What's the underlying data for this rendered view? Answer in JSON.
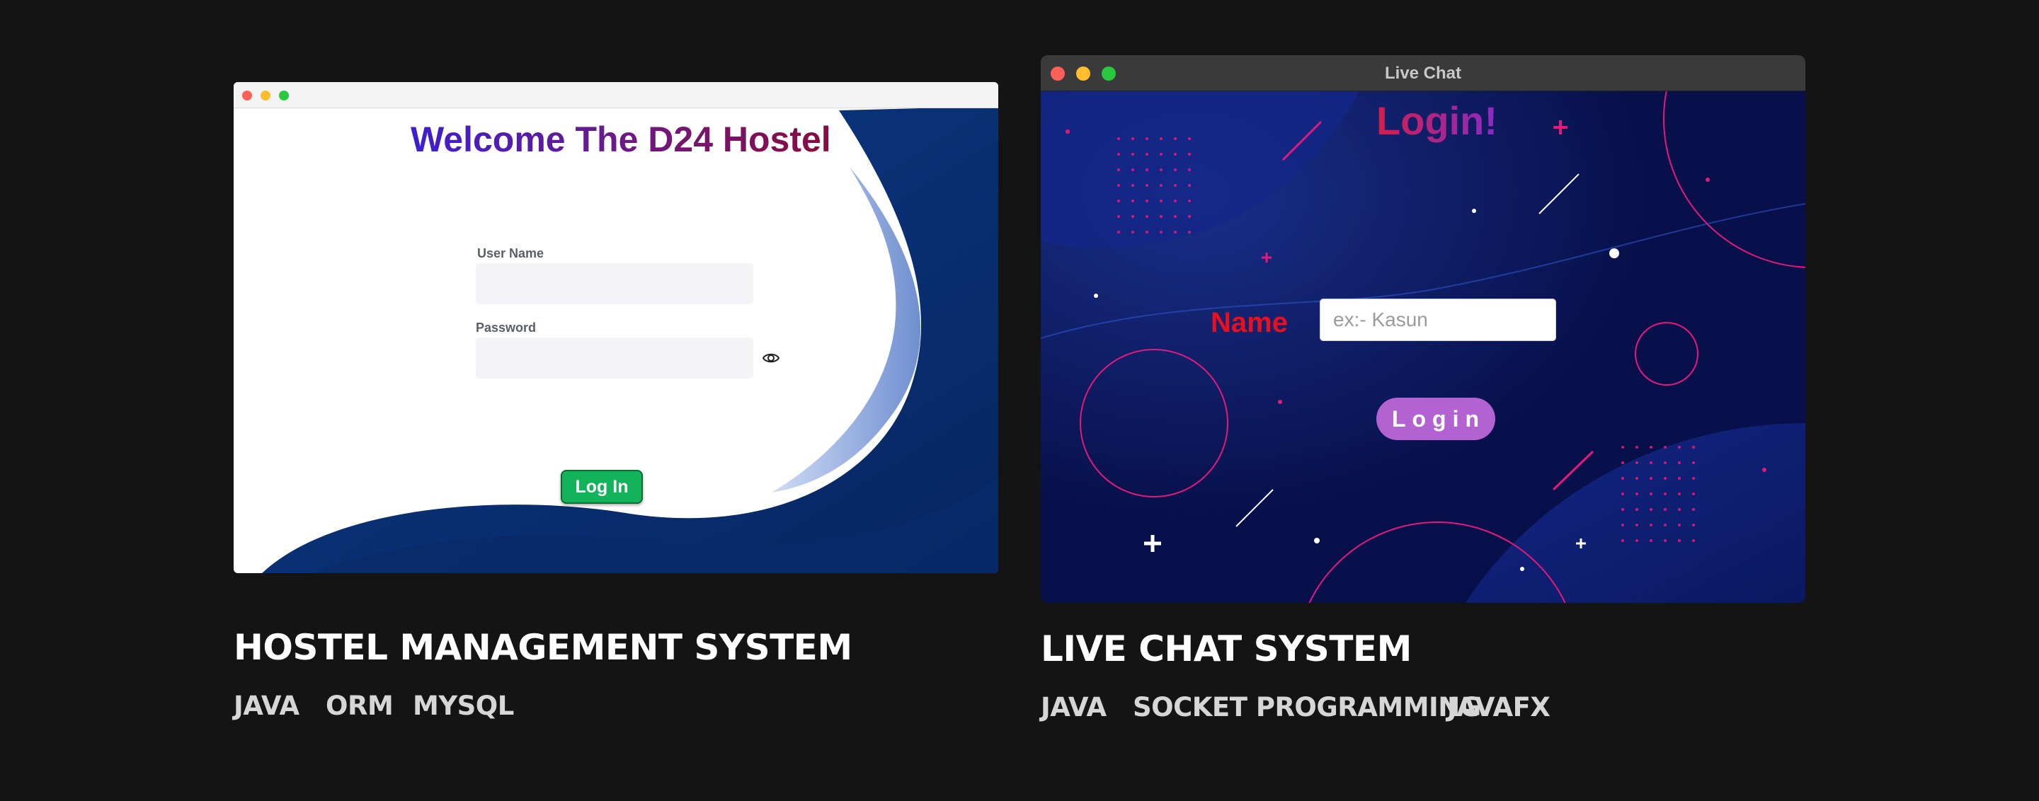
{
  "projects": [
    {
      "title": "HOSTEL MANAGEMENT SYSTEM",
      "tags": [
        "JAVA",
        "ORM",
        "MYSQL"
      ],
      "screenshot": {
        "welcome": "Welcome The D24 Hostel",
        "username_label": "User Name",
        "username_value": "",
        "password_label": "Password",
        "password_value": "",
        "login_button": "Log In",
        "button_color": "#12b35a"
      }
    },
    {
      "title": "LIVE CHAT SYSTEM",
      "tags": [
        "JAVA",
        "SOCKET PROGRAMMING",
        "JAVAFX"
      ],
      "screenshot": {
        "window_title": "Live Chat",
        "heading": "Login!",
        "name_label": "Name",
        "name_placeholder": "ex:- Kasun",
        "login_button": "Login",
        "button_color": "#b363d1"
      }
    }
  ],
  "colors": {
    "page_bg": "#141414",
    "traffic_red": "#fe5f57",
    "traffic_yellow": "#febc2e",
    "traffic_green": "#28c840"
  },
  "icons": [
    "eye-icon",
    "close-light",
    "minimize-light",
    "maximize-light"
  ]
}
